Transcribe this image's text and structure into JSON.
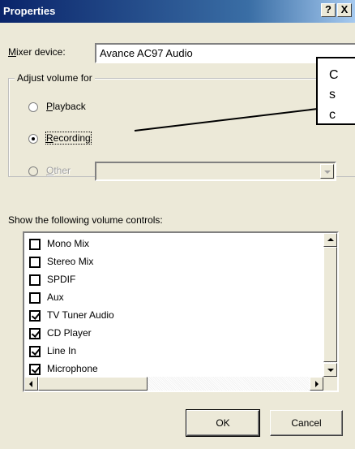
{
  "window": {
    "title": "Properties",
    "help_btn": "?",
    "close_btn": "X"
  },
  "mixer": {
    "label": "Mixer device:",
    "value": "Avance AC97 Audio"
  },
  "adjust_group": {
    "caption": "Adjust volume for",
    "options": [
      {
        "label": "Playback",
        "checked": false,
        "enabled": true
      },
      {
        "label": "Recording",
        "checked": true,
        "enabled": true
      },
      {
        "label": "Other",
        "checked": false,
        "enabled": false
      }
    ]
  },
  "controls": {
    "label": "Show the following volume controls:",
    "items": [
      {
        "label": "Mono Mix",
        "checked": false
      },
      {
        "label": "Stereo Mix",
        "checked": false
      },
      {
        "label": "SPDIF",
        "checked": false
      },
      {
        "label": "Aux",
        "checked": false
      },
      {
        "label": "TV Tuner Audio",
        "checked": true
      },
      {
        "label": "CD Player",
        "checked": true
      },
      {
        "label": "Line In",
        "checked": true
      },
      {
        "label": "Microphone",
        "checked": true
      }
    ]
  },
  "buttons": {
    "ok": "OK",
    "cancel": "Cancel"
  },
  "callout": {
    "lines": [
      "C",
      "s",
      "c"
    ]
  }
}
